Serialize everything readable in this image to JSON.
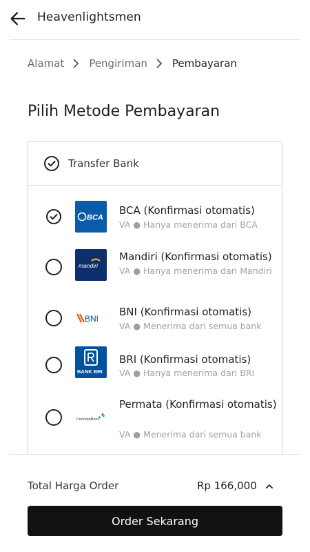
{
  "header": {
    "title": "Heavenlightsmen",
    "back_icon": "arrow-left-icon"
  },
  "breadcrumb": {
    "items": [
      "Alamat",
      "Pengiriman",
      "Pembayaran"
    ],
    "active_index": 2
  },
  "page": {
    "heading": "Pilih Metode Pembayaran"
  },
  "method_group": {
    "label": "Transfer Bank",
    "selected": true
  },
  "banks": [
    {
      "name": "BCA (Konfirmasi otomatis)",
      "desc": "VA ● Hanya menerima dari BCA",
      "logo_text": "BCA",
      "selected": true
    },
    {
      "name": "Mandiri (Konfirmasi otomatis)",
      "desc": "VA ● Hanya menerima dari Mandiri",
      "logo_text": "mandiri",
      "selected": false
    },
    {
      "name": "BNI (Konfirmasi otomatis)",
      "desc": "VA ● Menerima dari semua bank",
      "logo_text": "BNI",
      "selected": false
    },
    {
      "name": "BRI (Konfirmasi otomatis)",
      "desc": "VA ● Hanya menerima dari BRI",
      "logo_text": "BANK BRI",
      "selected": false
    },
    {
      "name": "Permata (Konfirmasi otomatis)",
      "desc": "VA ● Menerima dari semua bank",
      "logo_text": "PermataBank",
      "selected": false
    }
  ],
  "footer": {
    "total_label": "Total Harga Order",
    "total_value": "Rp 166,000",
    "order_button": "Order Sekarang"
  },
  "colors": {
    "primary": "#111111",
    "bca": "#0b5ca8",
    "mandiri": "#0e2f6b",
    "bni": "#f15a22",
    "bni_text": "#005e6a",
    "bri": "#00529c"
  }
}
